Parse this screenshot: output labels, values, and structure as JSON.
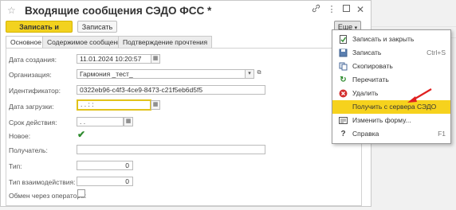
{
  "window": {
    "title": "Входящие сообщения СЭДО ФСС *",
    "icons": [
      "star-icon",
      "link-icon",
      "more-vertical-icon",
      "maximize-icon",
      "close-icon"
    ]
  },
  "toolbar": {
    "save_close_label": "Записать и закрыть",
    "save_label": "Записать",
    "more_label": "Еще"
  },
  "tabs": [
    {
      "label": "Основное",
      "active": true
    },
    {
      "label": "Содержимое сообщения",
      "active": false
    },
    {
      "label": "Подтверждение прочтения",
      "active": false
    }
  ],
  "form": {
    "created_label": "Дата создания:",
    "created_value": "11.01.2024 10:20:57",
    "org_label": "Организация:",
    "org_value": "Гармония _тест_",
    "id_label": "Идентификатор:",
    "id_value": "0322eb96-c4f3-4ce9-8473-c21f5eb6d5f5",
    "loaded_label": "Дата загрузки:",
    "loaded_value": " .  .       :  :",
    "valid_label": "Срок действия:",
    "valid_value": " .  .",
    "new_label": "Новое:",
    "new_checked": true,
    "recipient_label": "Получатель:",
    "recipient_value": "",
    "type_label": "Тип:",
    "type_value": "0",
    "interaction_label": "Тип взаимодействия:",
    "interaction_value": "0",
    "operator_label": "Обмен через оператора:",
    "operator_checked": false
  },
  "menu": {
    "items": [
      {
        "label": "Записать и закрыть",
        "shortcut": "",
        "icon": "save-close-icon",
        "highlighted": false
      },
      {
        "label": "Записать",
        "shortcut": "Ctrl+S",
        "icon": "save-icon",
        "highlighted": false
      },
      {
        "label": "Скопировать",
        "shortcut": "",
        "icon": "copy-icon",
        "highlighted": false
      },
      {
        "label": "Перечитать",
        "shortcut": "",
        "icon": "refresh-icon",
        "highlighted": false
      },
      {
        "label": "Удалить",
        "shortcut": "",
        "icon": "delete-icon",
        "highlighted": false
      },
      {
        "label": "Получить с сервера СЭДО",
        "shortcut": "",
        "icon": "",
        "highlighted": true
      },
      {
        "label": "Изменить форму...",
        "shortcut": "",
        "icon": "form-settings-icon",
        "highlighted": false
      },
      {
        "label": "Справка",
        "shortcut": "F1",
        "icon": "help-icon",
        "highlighted": false
      }
    ]
  },
  "colors": {
    "accent": "#f2d21f",
    "arrow": "#e02020",
    "check": "#2e8b2e",
    "delete": "#d32f2f",
    "refresh": "#2e8b2e"
  }
}
